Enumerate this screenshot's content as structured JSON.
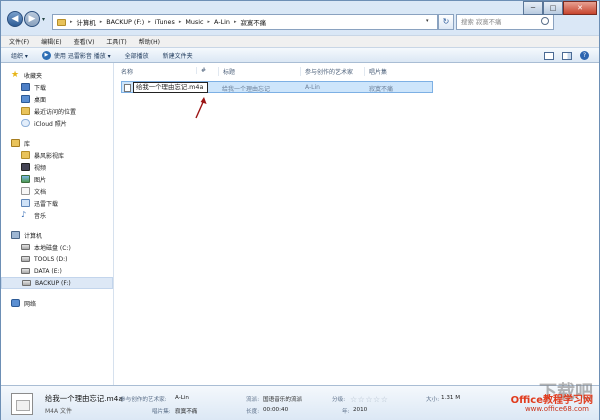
{
  "window": {
    "breadcrumbs": [
      "计算机",
      "BACKUP (F:)",
      "iTunes",
      "Music",
      "A-Lin",
      "寂寞不痛"
    ],
    "search_placeholder": "搜索 寂寞不痛",
    "controls": [
      "─",
      "□",
      "✕"
    ]
  },
  "menu": [
    "文件(F)",
    "编辑(E)",
    "查看(V)",
    "工具(T)",
    "帮助(H)"
  ],
  "toolbar": {
    "organize": "组织 ▾",
    "play_with": "使用 迅雷影音 播放 ▾",
    "play_all": "全部播放",
    "new_folder": "新建文件夹"
  },
  "nav": {
    "favorites": {
      "header": "收藏夹",
      "items": [
        "下载",
        "桌面",
        "最近访问的位置",
        "iCloud 照片"
      ]
    },
    "libraries": {
      "header": "库",
      "items": [
        "暴风影视库",
        "视频",
        "图片",
        "文档",
        "迅雷下载",
        "音乐"
      ]
    },
    "computer": {
      "header": "计算机",
      "items": [
        "本地磁盘 (C:)",
        "TOOLS (D:)",
        "DATA (E:)",
        "BACKUP (F:)"
      ]
    },
    "network": {
      "header": "网络"
    }
  },
  "columns": [
    "名称",
    "#",
    "标题",
    "参与创作的艺术家",
    "唱片集"
  ],
  "file": {
    "name": "给我一个理由忘记.m4a",
    "title": "给我一个理由忘记",
    "artist": "A-Lin",
    "album": "寂寞不痛"
  },
  "details": {
    "title": "给我一个理由忘记.m4a",
    "type": "M4A 文件",
    "labels": {
      "artist": "参与创作的艺术家:",
      "album": "唱片集:",
      "genre": "流派:",
      "length": "长度:",
      "rating": "分级:",
      "year": "年:",
      "size": "大小:"
    },
    "values": {
      "artist": "A-Lin",
      "album": "寂寞不痛",
      "genre": "国语音乐的流派",
      "length": "00:00:40",
      "rating": "☆☆☆☆☆",
      "year": "2010",
      "size": "1.31 M"
    }
  },
  "watermark": {
    "top": "下载吧",
    "main": "Office教程学习网",
    "url": "www.office68.com"
  }
}
